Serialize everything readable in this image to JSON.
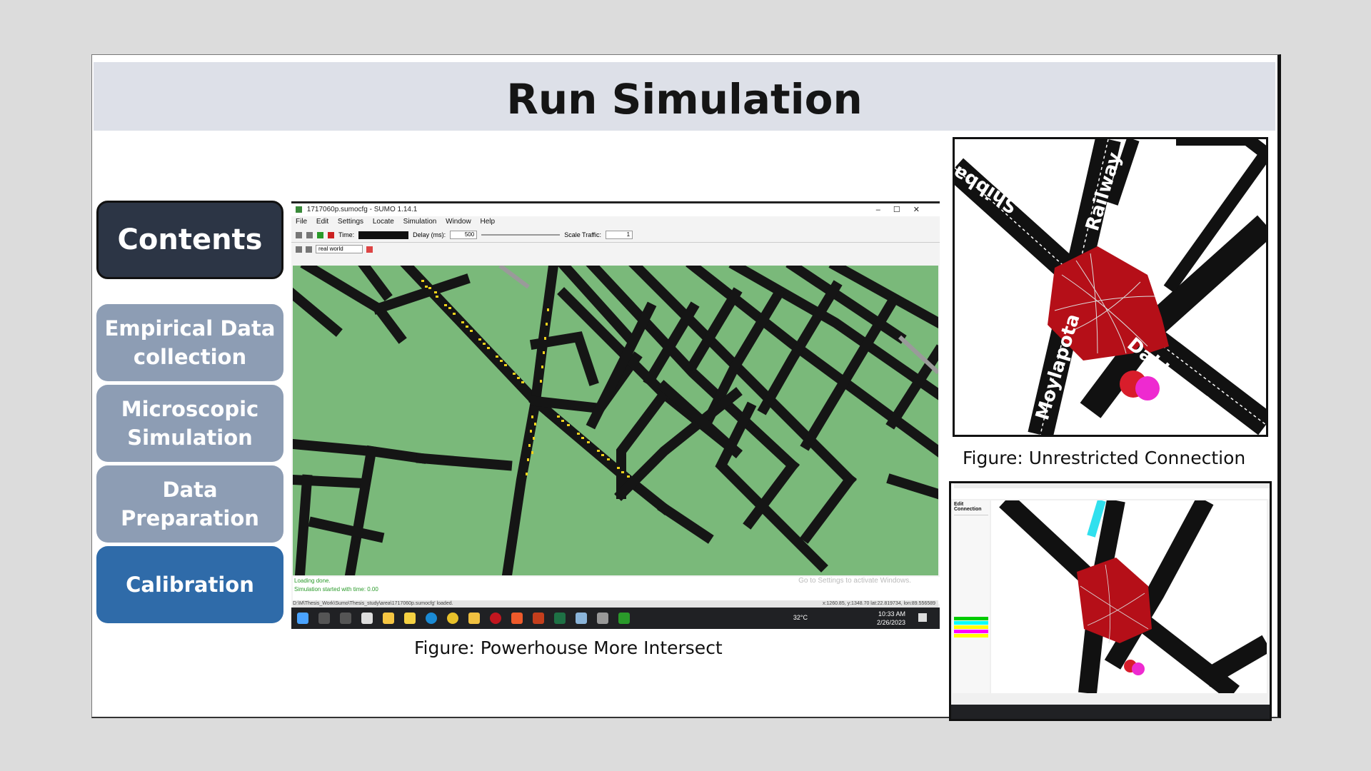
{
  "slide": {
    "title": "Run Simulation"
  },
  "sidebar": {
    "contents_label": "Contents",
    "items": [
      {
        "label_line1": "Empirical Data",
        "label_line2": "collection"
      },
      {
        "label_line1": "Microscopic",
        "label_line2": "Simulation"
      },
      {
        "label_line1": "Data",
        "label_line2": "Preparation"
      },
      {
        "label_line1": "Calibration",
        "label_line2": ""
      }
    ]
  },
  "sumo_window": {
    "title": "1717060p.sumocfg - SUMO 1.14.1",
    "menu": [
      "File",
      "Edit",
      "Settings",
      "Locate",
      "Simulation",
      "Window",
      "Help"
    ],
    "time_label": "Time:",
    "delay_label": "Delay (ms):",
    "delay_value": "500",
    "scale_label": "Scale Traffic:",
    "scale_value": "1",
    "view_scheme": "real world",
    "messages": [
      "Loading done.",
      "Simulation started with time: 0.00"
    ],
    "watermark": "Go to Settings to activate Windows.",
    "status_path": "D:\\M\\Thesis_Work\\Sumo\\Thesis_study\\area\\1717060p.sumocfg' loaded.",
    "status_coords": "x:1260.85, y:1348.70  lat:22.819734, lon:89.556589",
    "taskbar": {
      "temperature": "32°C",
      "time": "10:33 AM",
      "date": "2/26/2023"
    }
  },
  "captions": {
    "main": "Figure: Powerhouse More Intersect",
    "right_top": "Figure: Unrestricted Connection"
  },
  "map_labels": [
    "Railway",
    "Shibbari",
    "Moylapota",
    "Dakbangla"
  ],
  "netedit": {
    "panel_title": "Edit Connection"
  },
  "colors": {
    "title_band": "#dde0e8",
    "contents_button": "#2c3545",
    "gray_button": "#8d9db4",
    "calibration_button": "#2f6ba9",
    "map_green": "#7ab97a",
    "intersection_red": "#b50f18"
  }
}
